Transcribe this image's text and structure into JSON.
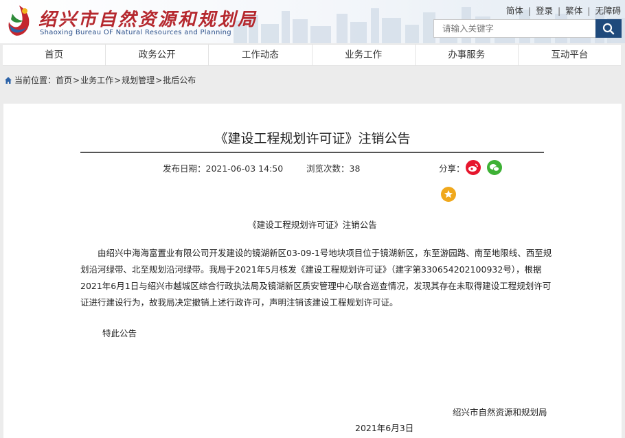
{
  "header": {
    "logo_cn": "绍兴市自然资源和规划局",
    "logo_en": "Shaoxing Bureau OF Natural Resources and Planning",
    "top_links": [
      "简体",
      "登录",
      "繁体",
      "无障碍"
    ],
    "search_placeholder": "请输入关键字"
  },
  "nav": {
    "items": [
      "首页",
      "政务公开",
      "工作动态",
      "业务工作",
      "办事服务",
      "互动平台"
    ]
  },
  "breadcrumb": {
    "label": "当前位置：",
    "items": [
      "首页",
      "业务工作",
      "规划管理",
      "批后公布"
    ],
    "separator": ">"
  },
  "article": {
    "title": "《建设工程规划许可证》注销公告",
    "publish_date": "发布日期：2021-06-03 14:50",
    "views": "浏览次数：38",
    "share_label": "分享：",
    "body_heading": "《建设工程规划许可证》注销公告",
    "body_text": "由绍兴中海海富置业有限公司开发建设的镜湖新区03-09-1号地块项目位于镜湖新区，东至游园路、南至地限线、西至规划沿河绿带、北至规划沿河绿带。我局于2021年5月核发《建设工程规划许可证》（建字第330654202100932号），根据2021年6月1日与绍兴市越城区综合行政执法局及镜湖新区质安管理中心联合巡查情况，发现其存在未取得建设工程规划许可证进行建设行为，故我局决定撤销上述行政许可，声明注销该建设工程规划许可证。",
    "closing": "特此公告",
    "signature": "绍兴市自然资源和规划局",
    "sign_date": "2021年6月3日"
  },
  "colors": {
    "brand_red": "#b5282e",
    "brand_blue": "#1f4a7c",
    "weibo": "#e6162d",
    "wechat": "#3eb135",
    "favorite": "#f0a81c"
  }
}
